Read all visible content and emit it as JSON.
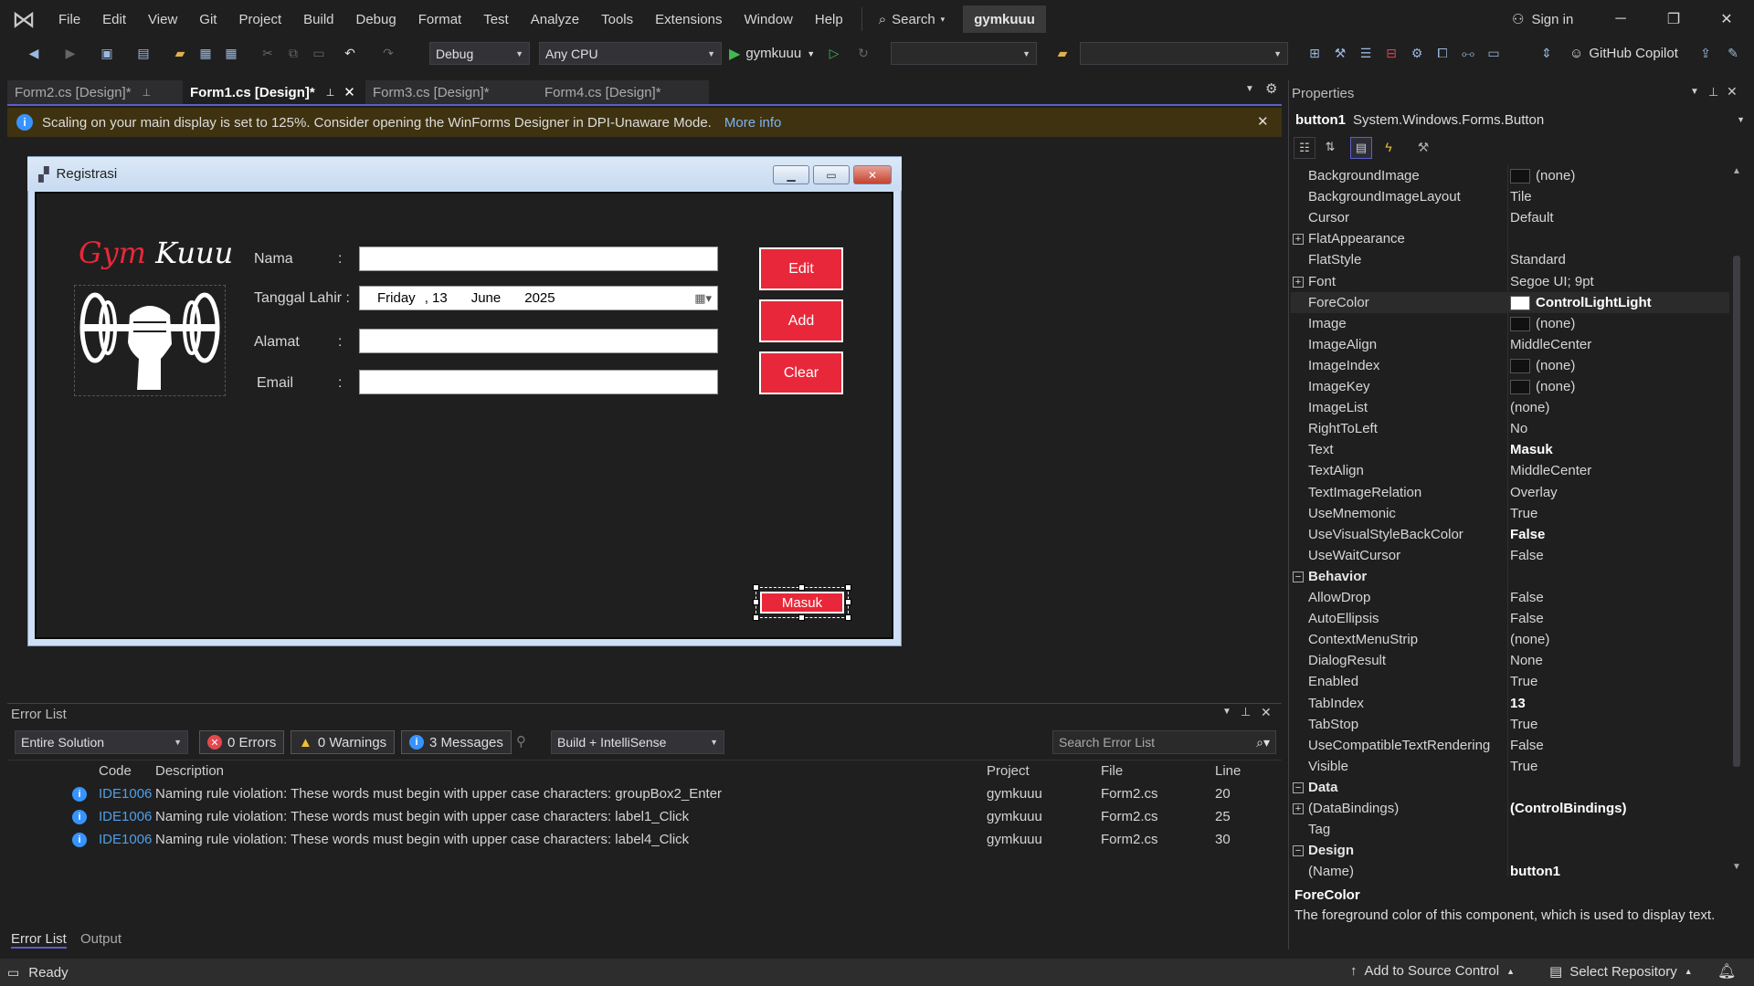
{
  "menubar": {
    "items": [
      "File",
      "Edit",
      "View",
      "Git",
      "Project",
      "Build",
      "Debug",
      "Format",
      "Test",
      "Analyze",
      "Tools",
      "Extensions",
      "Window",
      "Help"
    ],
    "search_label": "Search",
    "project_name": "gymkuuu",
    "signin_label": "Sign in"
  },
  "toolbar": {
    "config": "Debug",
    "platform": "Any CPU",
    "run_target": "gymkuuu",
    "copilot_label": "GitHub Copilot"
  },
  "doc_tabs": [
    {
      "label": "Form2.cs [Design]*"
    },
    {
      "label": "Form1.cs [Design]*"
    },
    {
      "label": "Form3.cs [Design]*"
    },
    {
      "label": "Form4.cs [Design]*"
    }
  ],
  "infobar": {
    "message": "Scaling on your main display is set to 125%. Consider opening the WinForms Designer in DPI-Unaware Mode.",
    "link": "More info"
  },
  "form": {
    "title": "Registrasi",
    "logo_gym": "Gym",
    "logo_kuuu": "Kuuu",
    "labels": {
      "nama": "Nama",
      "tanggal": "Tanggal Lahir :",
      "alamat": "Alamat",
      "email": "Email",
      "colon": ":"
    },
    "date": {
      "day_name": "Friday",
      "day": ", 13",
      "month": "June",
      "year": "2025"
    },
    "buttons": {
      "edit": "Edit",
      "add": "Add",
      "clear": "Clear",
      "masuk": "Masuk"
    }
  },
  "error_list": {
    "title": "Error List",
    "scope": "Entire Solution",
    "errors": "0 Errors",
    "warnings": "0 Warnings",
    "messages": "3 Messages",
    "source": "Build + IntelliSense",
    "search_placeholder": "Search Error List",
    "columns": {
      "code": "Code",
      "description": "Description",
      "project": "Project",
      "file": "File",
      "line": "Line"
    },
    "rows": [
      {
        "code": "IDE1006",
        "description": "Naming rule violation: These words must begin with upper case characters: groupBox2_Enter",
        "project": "gymkuuu",
        "file": "Form2.cs",
        "line": "20"
      },
      {
        "code": "IDE1006",
        "description": "Naming rule violation: These words must begin with upper case characters: label1_Click",
        "project": "gymkuuu",
        "file": "Form2.cs",
        "line": "25"
      },
      {
        "code": "IDE1006",
        "description": "Naming rule violation: These words must begin with upper case characters: label4_Click",
        "project": "gymkuuu",
        "file": "Form2.cs",
        "line": "30"
      }
    ],
    "bottom_tabs": [
      "Error List",
      "Output"
    ]
  },
  "properties": {
    "title": "Properties",
    "object_name": "button1",
    "object_type": "System.Windows.Forms.Button",
    "rows": [
      {
        "name": "BackgroundImage",
        "value": "(none)",
        "swatch": "dark"
      },
      {
        "name": "BackgroundImageLayout",
        "value": "Tile"
      },
      {
        "name": "Cursor",
        "value": "Default"
      },
      {
        "name": "FlatAppearance",
        "value": "",
        "expand": "+"
      },
      {
        "name": "FlatStyle",
        "value": "Standard"
      },
      {
        "name": "Font",
        "value": "Segoe UI; 9pt",
        "expand": "+"
      },
      {
        "name": "ForeColor",
        "value": "ControlLightLight",
        "swatch": "white",
        "bold": true
      },
      {
        "name": "Image",
        "value": "(none)",
        "swatch": "dark"
      },
      {
        "name": "ImageAlign",
        "value": "MiddleCenter"
      },
      {
        "name": "ImageIndex",
        "value": "(none)",
        "swatch": "dark"
      },
      {
        "name": "ImageKey",
        "value": "(none)",
        "swatch": "dark"
      },
      {
        "name": "ImageList",
        "value": "(none)"
      },
      {
        "name": "RightToLeft",
        "value": "No"
      },
      {
        "name": "Text",
        "value": "Masuk",
        "bold": true
      },
      {
        "name": "TextAlign",
        "value": "MiddleCenter"
      },
      {
        "name": "TextImageRelation",
        "value": "Overlay"
      },
      {
        "name": "UseMnemonic",
        "value": "True"
      },
      {
        "name": "UseVisualStyleBackColor",
        "value": "False",
        "bold": true
      },
      {
        "name": "UseWaitCursor",
        "value": "False"
      },
      {
        "name": "Behavior",
        "value": "",
        "category": true
      },
      {
        "name": "AllowDrop",
        "value": "False"
      },
      {
        "name": "AutoEllipsis",
        "value": "False"
      },
      {
        "name": "ContextMenuStrip",
        "value": "(none)"
      },
      {
        "name": "DialogResult",
        "value": "None"
      },
      {
        "name": "Enabled",
        "value": "True"
      },
      {
        "name": "TabIndex",
        "value": "13",
        "bold": true
      },
      {
        "name": "TabStop",
        "value": "True"
      },
      {
        "name": "UseCompatibleTextRendering",
        "value": "False"
      },
      {
        "name": "Visible",
        "value": "True"
      },
      {
        "name": "Data",
        "value": "",
        "category": true
      },
      {
        "name": "(DataBindings)",
        "value": "(ControlBindings)",
        "bold": true,
        "expand": "+"
      },
      {
        "name": "Tag",
        "value": ""
      },
      {
        "name": "Design",
        "value": "",
        "category": true
      },
      {
        "name": "(Name)",
        "value": "button1",
        "bold": true
      }
    ],
    "desc_title": "ForeColor",
    "desc_text": "The foreground color of this component, which is used to display text."
  },
  "statusbar": {
    "ready": "Ready",
    "source_control": "Add to Source Control",
    "repository": "Select Repository"
  },
  "colors": {
    "accent": "#5b5fc7",
    "button_red": "#e8283a",
    "info_blue": "#3794ff",
    "logo_red": "#e8283a"
  }
}
